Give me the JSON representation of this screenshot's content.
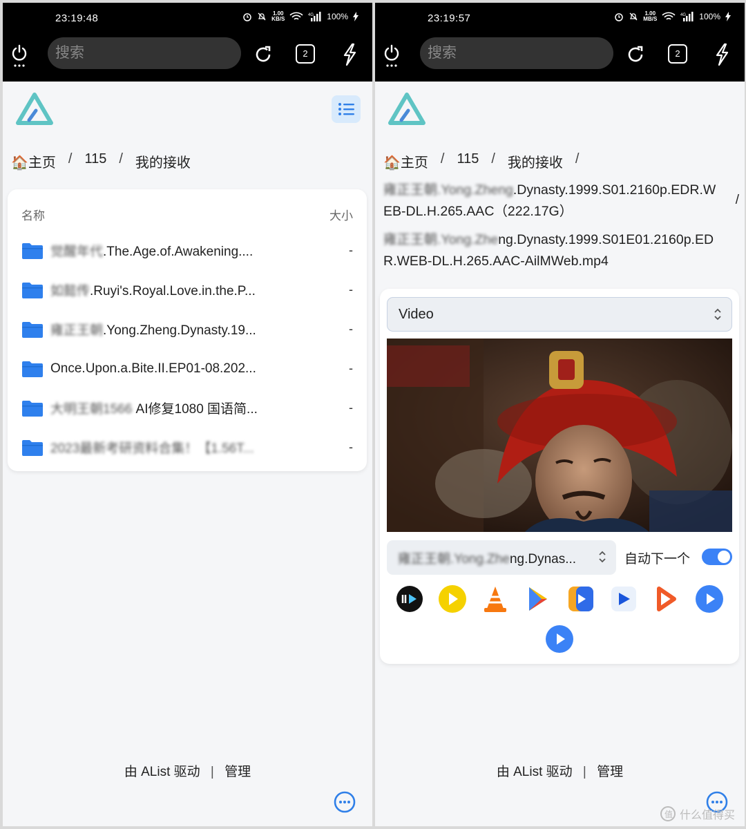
{
  "left": {
    "time": "23:19:48",
    "net_speed": "1.00\nKB/S",
    "battery": "100%",
    "search_placeholder": "搜索",
    "tab_count": "2",
    "breadcrumb": [
      "🏠主页",
      "115",
      "我的接收"
    ],
    "table_header": {
      "name": "名称",
      "size": "大小"
    },
    "files": [
      {
        "blurred": "觉醒年代",
        "name": ".The.Age.of.Awakening....",
        "size": "-"
      },
      {
        "blurred": "如懿传",
        "name": ".Ruyi's.Royal.Love.in.the.P...",
        "size": "-"
      },
      {
        "blurred": "雍正王朝",
        "name": ".Yong.Zheng.Dynasty.19...",
        "size": "-"
      },
      {
        "blurred": "",
        "name": "Once.Upon.a.Bite.II.EP01-08.202...",
        "size": "-"
      },
      {
        "blurred": "大明王朝1566",
        "name": " AI修复1080 国语简...",
        "size": "-"
      },
      {
        "blurred": "2023最新考研资料合集！【1.56T...",
        "name": "",
        "size": "-"
      }
    ],
    "footer": {
      "powered": "由 AList 驱动",
      "sep": "|",
      "admin": "管理"
    }
  },
  "right": {
    "time": "23:19:57",
    "net_speed": "1.00\nMB/S",
    "battery": "100%",
    "search_placeholder": "搜索",
    "tab_count": "2",
    "breadcrumb": [
      "🏠主页",
      "115",
      "我的接收"
    ],
    "folder_path": {
      "blurred": "雍正王朝.Yong.Zheng",
      "text": ".Dynasty.1999.S01.2160p.EDR.WEB-DL.H.265.AAC（222.17G）"
    },
    "file_path": {
      "blurred": "雍正王朝.Yong.Zhe",
      "text": "ng.Dynasty.1999.S01E01.2160p.EDR.WEB-DL.H.265.AAC-AilMWeb.mp4"
    },
    "slash": "/",
    "player_type": "Video",
    "episode": {
      "blurred": "雍正王朝.Yong.Zhe",
      "text": "ng.Dynas..."
    },
    "auto_next": "自动下一个",
    "auto_next_on": true,
    "footer": {
      "powered": "由 AList 驱动",
      "sep": "|",
      "admin": "管理"
    }
  },
  "watermark": "什么值得买",
  "colors": {
    "accent": "#3b82f6",
    "folder": "#2f80ed",
    "logo": "#5fc4c4",
    "topbar": "#000000"
  }
}
